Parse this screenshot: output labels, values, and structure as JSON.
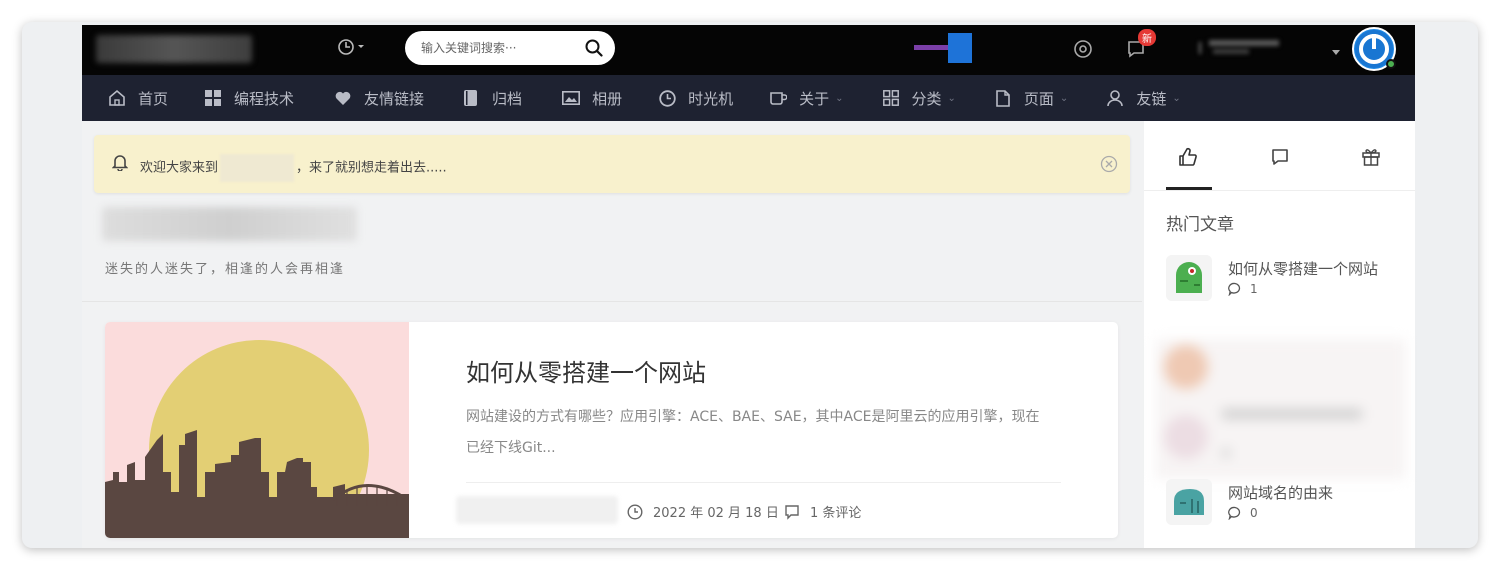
{
  "topbar": {
    "search_placeholder": "输入关键词搜索···",
    "notification_badge": "新"
  },
  "nav": {
    "items": [
      {
        "label": "首页",
        "icon": "home-icon",
        "dropdown": false
      },
      {
        "label": "编程技术",
        "icon": "grid-icon",
        "dropdown": false
      },
      {
        "label": "友情链接",
        "icon": "heart-icon",
        "dropdown": false
      },
      {
        "label": "归档",
        "icon": "book-icon",
        "dropdown": false
      },
      {
        "label": "相册",
        "icon": "image-icon",
        "dropdown": false
      },
      {
        "label": "时光机",
        "icon": "clock-icon",
        "dropdown": false
      },
      {
        "label": "关于",
        "icon": "coffee-icon",
        "dropdown": true
      },
      {
        "label": "分类",
        "icon": "apps-icon",
        "dropdown": true
      },
      {
        "label": "页面",
        "icon": "file-icon",
        "dropdown": true
      },
      {
        "label": "友链",
        "icon": "user-icon",
        "dropdown": true
      }
    ]
  },
  "notice": {
    "prefix": "欢迎大家来到",
    "suffix": "，来了就别想走着出去.....",
    "icon": "bell-icon"
  },
  "site": {
    "subtitle": "迷失的人迷失了，相逢的人会再相逢"
  },
  "post": {
    "title": "如何从零搭建一个网站",
    "excerpt": "网站建设的方式有哪些？应用引擎：ACE、BAE、SAE，其中ACE是阿里云的应用引擎，现在已经下线Git...",
    "date": "2022 年 02 月 18 日",
    "comments": "1 条评论",
    "colors": {
      "thumb_bg": "#fbdcdc",
      "sun": "#e3cf74",
      "city": "#5a4741"
    }
  },
  "sidebar": {
    "tabs": [
      "thumbs-up-icon",
      "comment-icon",
      "gift-icon"
    ],
    "heading": "热门文章",
    "hot_posts": [
      {
        "title": "如何从零搭建一个网站",
        "comments": "1",
        "thumb_color": "#4caf50"
      },
      {
        "title": "网站域名的由来",
        "comments": "0",
        "thumb_color": "#4aa3a3"
      }
    ]
  }
}
